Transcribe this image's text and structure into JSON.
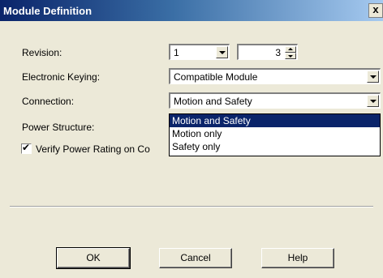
{
  "window": {
    "title": "Module Definition",
    "close_glyph": "x"
  },
  "form": {
    "revision_label": "Revision:",
    "revision_major": "1",
    "revision_minor": "3",
    "keying_label": "Electronic Keying:",
    "keying_value": "Compatible Module",
    "connection_label": "Connection:",
    "connection_value": "Motion and Safety",
    "power_structure_label": "Power Structure:",
    "verify_label": "Verify Power Rating on Co",
    "verify_checked": true
  },
  "dropdown": {
    "options": [
      "Motion and Safety",
      "Motion only",
      "Safety only"
    ],
    "selected_index": 0
  },
  "buttons": {
    "ok": "OK",
    "cancel": "Cancel",
    "help": "Help"
  },
  "colors": {
    "title_bar": "#0a246a",
    "selection": "#0a246a",
    "dialog_bg": "#ece9d8"
  }
}
